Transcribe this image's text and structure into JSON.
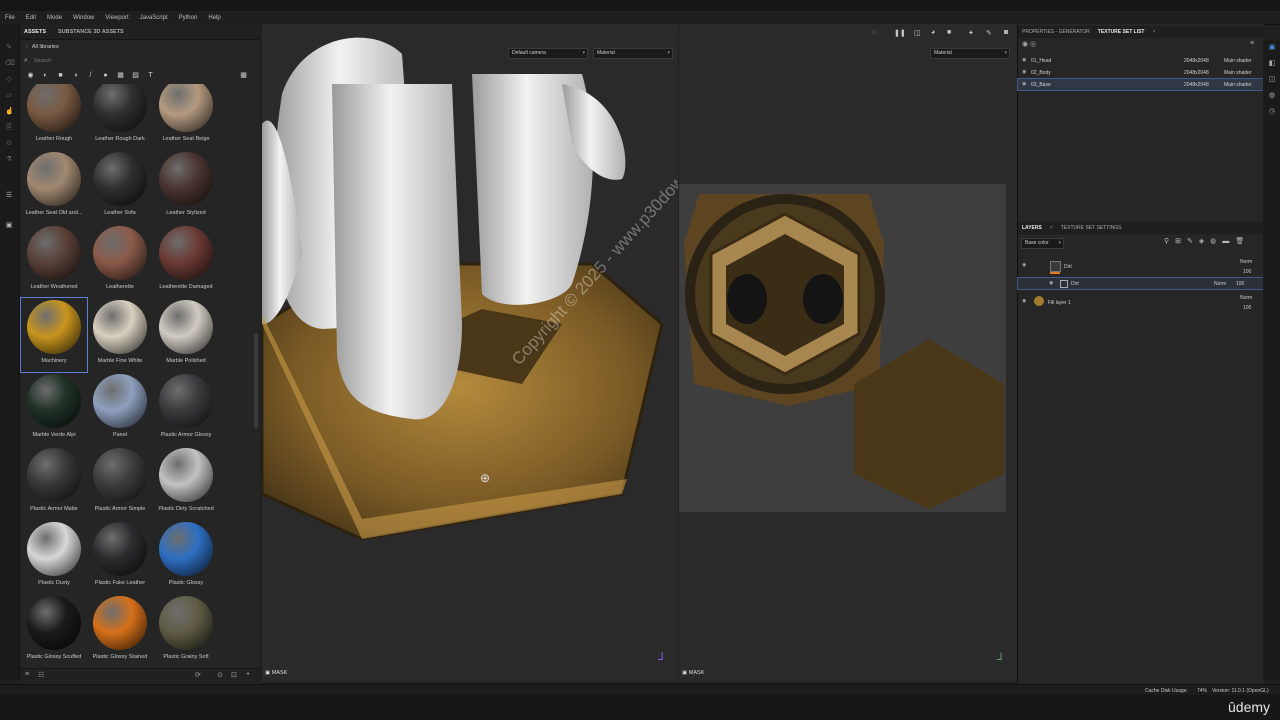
{
  "menu": [
    "File",
    "Edit",
    "Mode",
    "Window",
    "Viewport",
    "JavaScript",
    "Python",
    "Help"
  ],
  "assets": {
    "tabs": [
      "ASSETS",
      "SUBSTANCE 3D ASSETS"
    ],
    "library": "All libraries",
    "search_placeholder": "Search",
    "items": [
      {
        "label": "Leather Rough",
        "color": "#7a5a43"
      },
      {
        "label": "Leather Rough Dark",
        "color": "#2f2f2f"
      },
      {
        "label": "Leather Seat Beige",
        "color": "#b49a80"
      },
      {
        "label": "Leather Seat Old and...",
        "color": "#a08870"
      },
      {
        "label": "Leather Sofa",
        "color": "#2e2e2e"
      },
      {
        "label": "Leather Stylized",
        "color": "#4a3430"
      },
      {
        "label": "Leather Weathered",
        "color": "#5a4038"
      },
      {
        "label": "Leatherette",
        "color": "#8b5a4a"
      },
      {
        "label": "Leatherette Damaged",
        "color": "#6b3a34"
      },
      {
        "label": "Machinery",
        "color": "#c8951f"
      },
      {
        "label": "Marble Fine White",
        "color": "#d8d0c0"
      },
      {
        "label": "Marble Polished",
        "color": "#d0cbc3"
      },
      {
        "label": "Marble Verde Alpi",
        "color": "#1f3126"
      },
      {
        "label": "Panel",
        "color": "#8ea0bf"
      },
      {
        "label": "Plastic Armor Glossy",
        "color": "#3b3b3d"
      },
      {
        "label": "Plastic Armor Matte",
        "color": "#383838"
      },
      {
        "label": "Plastic Armor Simple",
        "color": "#3d3d3d"
      },
      {
        "label": "Plastic Dirty Scratched",
        "color": "#c2c2c2"
      },
      {
        "label": "Plastic Dusty",
        "color": "#d7d7d7"
      },
      {
        "label": "Plastic Fake Leather",
        "color": "#2c2c2e"
      },
      {
        "label": "Plastic Glossy",
        "color": "#2e6fc2"
      },
      {
        "label": "Plastic Glossy Scuffed",
        "color": "#1a1a1a"
      },
      {
        "label": "Plastic Glossy Stained",
        "color": "#d6701a"
      },
      {
        "label": "Plastic Grainy Soft",
        "color": "#5f5d45"
      }
    ],
    "selected_label": "Machinery"
  },
  "viewport": {
    "camera": "Default camera",
    "material_left": "Material",
    "material_right": "Material",
    "mask_left": "MASK",
    "mask_right": "MASK",
    "watermark": "Copyright © 2025 - www.p30download.com"
  },
  "properties": {
    "tabs": [
      "PROPERTIES - GENERATOR",
      "TEXTURE SET LIST"
    ],
    "rows": [
      {
        "name": "01_Head",
        "res": "2048x2048",
        "shader": "Main shader"
      },
      {
        "name": "02_Body",
        "res": "2048x2048",
        "shader": "Main shader"
      },
      {
        "name": "03_Base",
        "res": "2048x2048",
        "shader": "Main shader"
      }
    ]
  },
  "layers": {
    "tabs": [
      "LAYERS",
      "TEXTURE SET SETTINGS"
    ],
    "channel": "Base color",
    "items": [
      {
        "name": "Dirt",
        "blend": "Norm",
        "opacity": "100"
      },
      {
        "name": "Dirt",
        "blend": "Norm",
        "opacity": "100"
      },
      {
        "name": "Fill layer 1",
        "blend": "Norm",
        "opacity": "100"
      }
    ]
  },
  "status": {
    "cache": "Cache Disk Usage:",
    "cache_val": "74%",
    "version": "Version: 11.0.1 (OpenGL)"
  },
  "brand": "ûdemy"
}
